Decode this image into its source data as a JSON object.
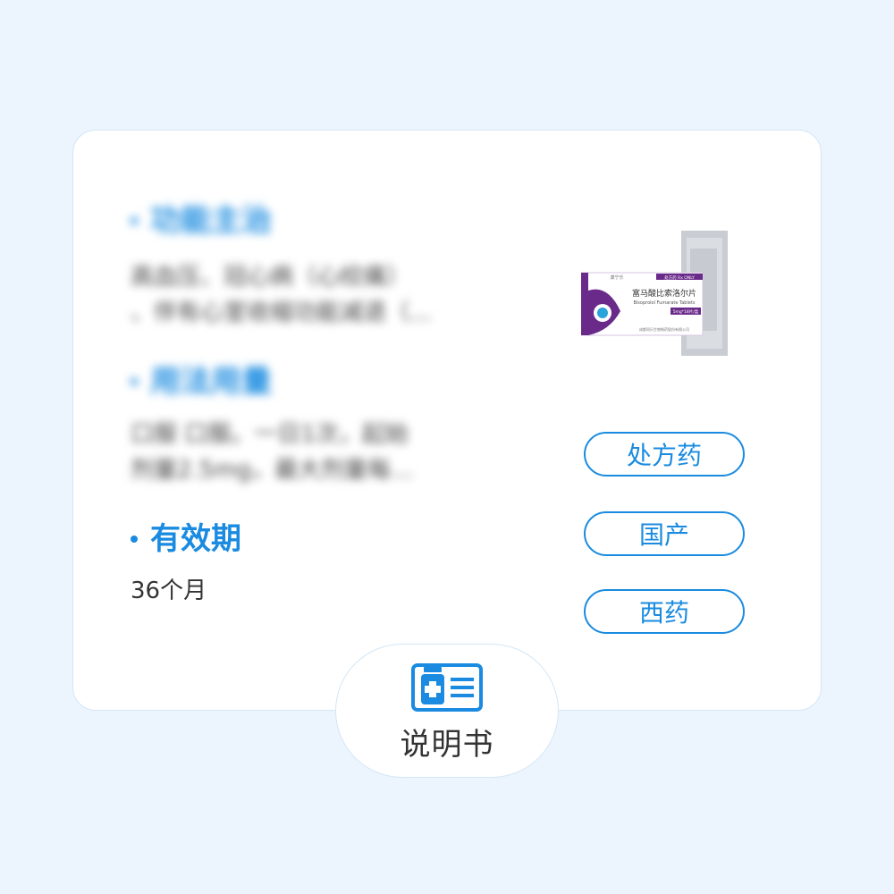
{
  "sections": [
    {
      "title": "功能主治",
      "text_lines": [
        "高血压、冠心病（心绞痛）",
        "、伴有心室收缩功能减退（..."
      ]
    },
    {
      "title": "用法用量",
      "text_lines": [
        "口服 口服。一日1次，起始",
        "剂量2.5mg，最大剂量每..."
      ]
    },
    {
      "title": "有效期",
      "text_lines": [
        "36个月"
      ]
    }
  ],
  "tags": [
    "处方药",
    "国产",
    "西药"
  ],
  "product": {
    "name_cn": "富马酸比索洛尔片",
    "name_en": "Bisoprolol Fumarate Tablets",
    "spec": "5mg*18片/盒",
    "rx_banner": "处方药 Rx ONLY",
    "brand": "康宁乐",
    "manufacturer": "成都同乐生物制药股份有限公司"
  },
  "manual": {
    "label": "说明书",
    "icon": "medicine-manual-icon"
  },
  "colors": {
    "accent": "#1a8be0",
    "background": "#ecf5fd",
    "product_purple": "#6a2a8a"
  }
}
